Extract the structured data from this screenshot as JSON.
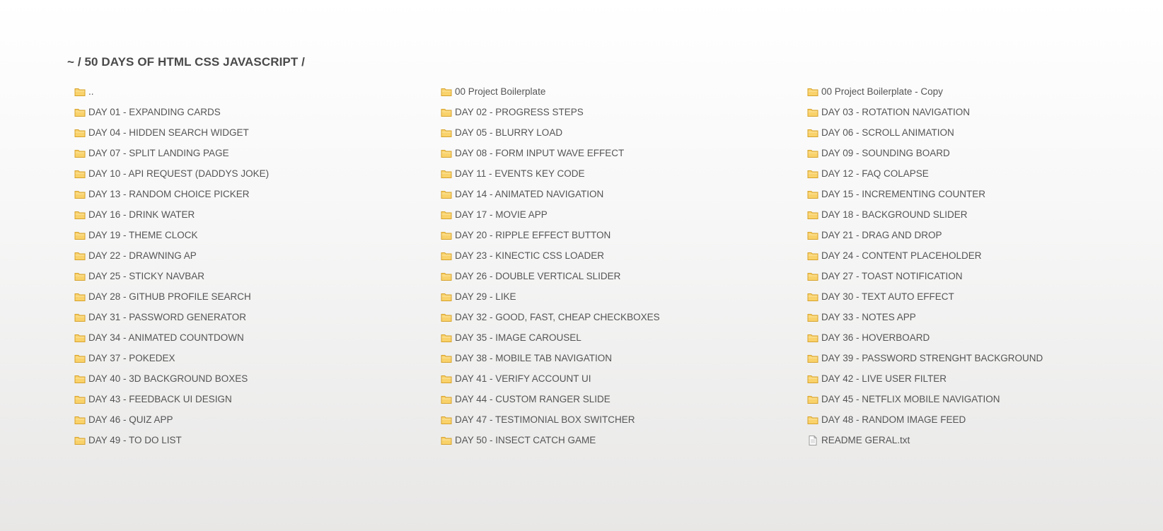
{
  "breadcrumb": "~ / 50 DAYS OF HTML CSS JAVASCRIPT /",
  "colors": {
    "text": "#555555",
    "heading": "#4a4a4a",
    "folder_fill": "#f9d26b",
    "folder_stroke": "#d6a22b",
    "file_fill": "#ffffff",
    "file_stroke": "#9a9a9a"
  },
  "entries": [
    {
      "name": "..",
      "type": "folder",
      "icon": "folder-icon"
    },
    {
      "name": "00 Project Boilerplate",
      "type": "folder",
      "icon": "folder-icon"
    },
    {
      "name": "00 Project Boilerplate - Copy",
      "type": "folder",
      "icon": "folder-icon"
    },
    {
      "name": "DAY 01 - EXPANDING CARDS",
      "type": "folder",
      "icon": "folder-icon"
    },
    {
      "name": "DAY 02 - PROGRESS STEPS",
      "type": "folder",
      "icon": "folder-icon"
    },
    {
      "name": "DAY 03 - ROTATION NAVIGATION",
      "type": "folder",
      "icon": "folder-icon"
    },
    {
      "name": "DAY 04 - HIDDEN SEARCH WIDGET",
      "type": "folder",
      "icon": "folder-icon"
    },
    {
      "name": "DAY 05 - BLURRY LOAD",
      "type": "folder",
      "icon": "folder-icon"
    },
    {
      "name": "DAY 06 - SCROLL ANIMATION",
      "type": "folder",
      "icon": "folder-icon"
    },
    {
      "name": "DAY 07 - SPLIT LANDING PAGE",
      "type": "folder",
      "icon": "folder-icon"
    },
    {
      "name": "DAY 08 - FORM INPUT WAVE EFFECT",
      "type": "folder",
      "icon": "folder-icon"
    },
    {
      "name": "DAY 09 - SOUNDING BOARD",
      "type": "folder",
      "icon": "folder-icon"
    },
    {
      "name": "DAY 10 - API REQUEST (DADDYS JOKE)",
      "type": "folder",
      "icon": "folder-icon"
    },
    {
      "name": "DAY 11 - EVENTS KEY CODE",
      "type": "folder",
      "icon": "folder-icon"
    },
    {
      "name": "DAY 12 - FAQ COLAPSE",
      "type": "folder",
      "icon": "folder-icon"
    },
    {
      "name": "DAY 13 - RANDOM CHOICE PICKER",
      "type": "folder",
      "icon": "folder-icon"
    },
    {
      "name": "DAY 14 - ANIMATED NAVIGATION",
      "type": "folder",
      "icon": "folder-icon"
    },
    {
      "name": "DAY 15 - INCREMENTING COUNTER",
      "type": "folder",
      "icon": "folder-icon"
    },
    {
      "name": "DAY 16 - DRINK WATER",
      "type": "folder",
      "icon": "folder-icon"
    },
    {
      "name": "DAY 17 - MOVIE APP",
      "type": "folder",
      "icon": "folder-icon"
    },
    {
      "name": "DAY 18 - BACKGROUND SLIDER",
      "type": "folder",
      "icon": "folder-icon"
    },
    {
      "name": "DAY 19 - THEME CLOCK",
      "type": "folder",
      "icon": "folder-icon"
    },
    {
      "name": "DAY 20 - RIPPLE EFFECT BUTTON",
      "type": "folder",
      "icon": "folder-icon"
    },
    {
      "name": "DAY 21 - DRAG AND DROP",
      "type": "folder",
      "icon": "folder-icon"
    },
    {
      "name": "DAY 22 - DRAWNING AP",
      "type": "folder",
      "icon": "folder-icon"
    },
    {
      "name": "DAY 23 - KINECTIC CSS LOADER",
      "type": "folder",
      "icon": "folder-icon"
    },
    {
      "name": "DAY 24 - CONTENT PLACEHOLDER",
      "type": "folder",
      "icon": "folder-icon"
    },
    {
      "name": "DAY 25 - STICKY NAVBAR",
      "type": "folder",
      "icon": "folder-icon"
    },
    {
      "name": "DAY 26 - DOUBLE VERTICAL SLIDER",
      "type": "folder",
      "icon": "folder-icon"
    },
    {
      "name": "DAY 27 - TOAST NOTIFICATION",
      "type": "folder",
      "icon": "folder-icon"
    },
    {
      "name": "DAY 28 - GITHUB PROFILE SEARCH",
      "type": "folder",
      "icon": "folder-icon"
    },
    {
      "name": "DAY 29 - LIKE",
      "type": "folder",
      "icon": "folder-icon"
    },
    {
      "name": "DAY 30 - TEXT AUTO EFFECT",
      "type": "folder",
      "icon": "folder-icon"
    },
    {
      "name": "DAY 31 - PASSWORD GENERATOR",
      "type": "folder",
      "icon": "folder-icon"
    },
    {
      "name": "DAY 32 - GOOD, FAST, CHEAP CHECKBOXES",
      "type": "folder",
      "icon": "folder-icon"
    },
    {
      "name": "DAY 33 - NOTES APP",
      "type": "folder",
      "icon": "folder-icon"
    },
    {
      "name": "DAY 34 - ANIMATED COUNTDOWN",
      "type": "folder",
      "icon": "folder-icon"
    },
    {
      "name": "DAY 35 - IMAGE CAROUSEL",
      "type": "folder",
      "icon": "folder-icon"
    },
    {
      "name": "DAY 36 - HOVERBOARD",
      "type": "folder",
      "icon": "folder-icon"
    },
    {
      "name": "DAY 37 - POKEDEX",
      "type": "folder",
      "icon": "folder-icon"
    },
    {
      "name": "DAY 38 - MOBILE TAB NAVIGATION",
      "type": "folder",
      "icon": "folder-icon"
    },
    {
      "name": "DAY 39 - PASSWORD STRENGHT BACKGROUND",
      "type": "folder",
      "icon": "folder-icon"
    },
    {
      "name": "DAY 40 - 3D BACKGROUND BOXES",
      "type": "folder",
      "icon": "folder-icon"
    },
    {
      "name": "DAY 41 - VERIFY ACCOUNT UI",
      "type": "folder",
      "icon": "folder-icon"
    },
    {
      "name": "DAY 42 - LIVE USER FILTER",
      "type": "folder",
      "icon": "folder-icon"
    },
    {
      "name": "DAY 43 - FEEDBACK UI DESIGN",
      "type": "folder",
      "icon": "folder-icon"
    },
    {
      "name": "DAY 44 - CUSTOM RANGER SLIDE",
      "type": "folder",
      "icon": "folder-icon"
    },
    {
      "name": "DAY 45 - NETFLIX MOBILE NAVIGATION",
      "type": "folder",
      "icon": "folder-icon"
    },
    {
      "name": "DAY 46 - QUIZ APP",
      "type": "folder",
      "icon": "folder-icon"
    },
    {
      "name": "DAY 47 - TESTIMONIAL BOX SWITCHER",
      "type": "folder",
      "icon": "folder-icon"
    },
    {
      "name": "DAY 48 - RANDOM IMAGE FEED",
      "type": "folder",
      "icon": "folder-icon"
    },
    {
      "name": "DAY 49 - TO DO LIST",
      "type": "folder",
      "icon": "folder-icon"
    },
    {
      "name": "DAY 50 - INSECT CATCH GAME",
      "type": "folder",
      "icon": "folder-icon"
    },
    {
      "name": "README GERAL.txt",
      "type": "file",
      "icon": "text-file-icon"
    }
  ]
}
